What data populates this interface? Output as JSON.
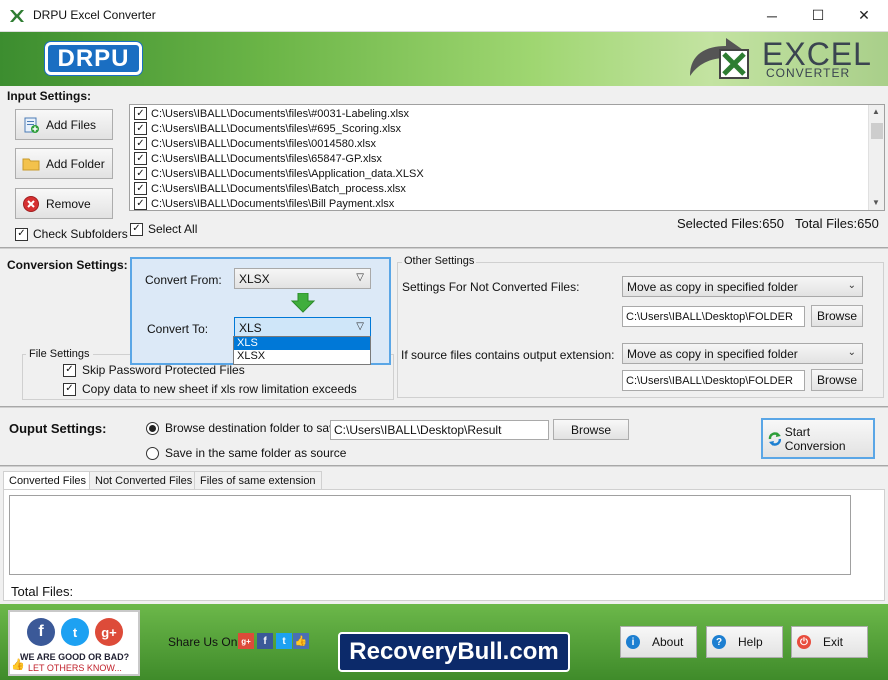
{
  "window": {
    "title": "DRPU Excel Converter",
    "minimize": "─",
    "maximize": "☐",
    "close": "✕"
  },
  "banner": {
    "brand": "DRPU",
    "product_big": "EXCEL",
    "product_small": "CONVERTER"
  },
  "input": {
    "label": "Input Settings:",
    "add_files": "Add Files",
    "add_folder": "Add Folder",
    "remove": "Remove",
    "check_subfolders": "Check Subfolders",
    "select_all": "Select All",
    "selected_files": "Selected Files:650",
    "total_files": "Total Files:650",
    "files": [
      "C:\\Users\\IBALL\\Documents\\files\\#0031-Labeling.xlsx",
      "C:\\Users\\IBALL\\Documents\\files\\#695_Scoring.xlsx",
      "C:\\Users\\IBALL\\Documents\\files\\0014580.xlsx",
      "C:\\Users\\IBALL\\Documents\\files\\65847-GP.xlsx",
      "C:\\Users\\IBALL\\Documents\\files\\Application_data.XLSX",
      "C:\\Users\\IBALL\\Documents\\files\\Batch_process.xlsx",
      "C:\\Users\\IBALL\\Documents\\files\\Bill Payment.xlsx"
    ]
  },
  "conversion": {
    "label": "Conversion Settings:",
    "convert_from_label": "Convert From:",
    "convert_from_value": "XLSX",
    "convert_to_label": "Convert To:",
    "convert_to_value": "XLS",
    "options": [
      "XLS",
      "XLSX"
    ],
    "file_settings_label": "File Settings",
    "skip_password": "Skip Password Protected Files",
    "copy_data": "Copy data to new sheet if xls row limitation exceeds"
  },
  "other": {
    "label": "Other Settings",
    "not_converted_label": "Settings For Not Converted Files:",
    "not_converted_value": "Move as copy in specified folder",
    "not_converted_path": "C:\\Users\\IBALL\\Desktop\\FOLDER",
    "source_ext_label": "If source files contains output extension:",
    "source_ext_value": "Move as copy in specified folder",
    "source_ext_path": "C:\\Users\\IBALL\\Desktop\\FOLDER",
    "browse": "Browse"
  },
  "output": {
    "label": "Ouput Settings:",
    "browse_dest": "Browse destination folder to save",
    "dest_path": "C:\\Users\\IBALL\\Desktop\\Result",
    "browse": "Browse",
    "same_folder": "Save in the same folder as source",
    "start": "Start Conversion"
  },
  "tabs": [
    "Converted Files",
    "Not Converted Files",
    "Files of same extension"
  ],
  "total_files_label": "Total Files:",
  "footer": {
    "rating_line1": "WE ARE GOOD OR BAD?",
    "rating_line2": "LET OTHERS KNOW...",
    "share_label": "Share Us On:",
    "recovery": "RecoveryBull.com",
    "about": "About",
    "help": "Help",
    "exit": "Exit"
  },
  "colors": {
    "accent_blue": "#5aa6e6",
    "banner_green": "#6bb547",
    "footer_green": "#4f9a35",
    "selection": "#0078d7"
  }
}
